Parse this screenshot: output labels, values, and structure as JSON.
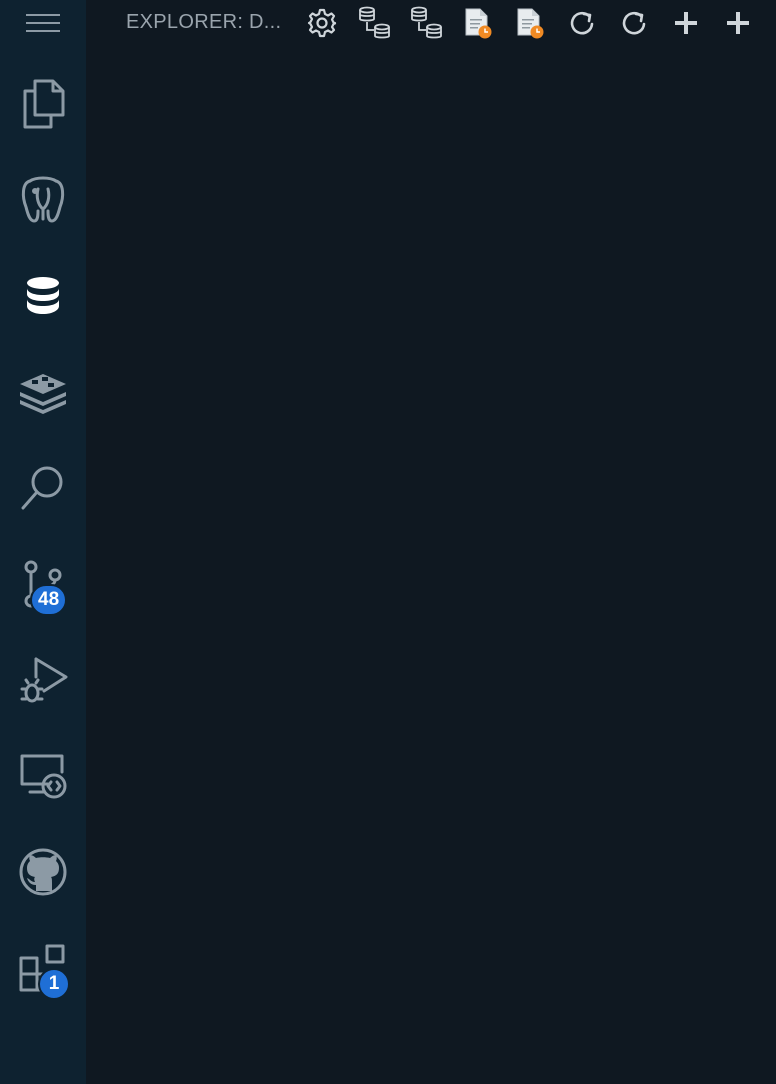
{
  "activity_bar": {
    "items": [
      {
        "name": "explorer",
        "icon": "files-icon"
      },
      {
        "name": "postgresql",
        "icon": "elephant-icon"
      },
      {
        "name": "database",
        "icon": "database-icon"
      },
      {
        "name": "redis",
        "icon": "layers-icon"
      },
      {
        "name": "search",
        "icon": "search-icon"
      },
      {
        "name": "source-control",
        "icon": "git-branch-icon",
        "badge": "48"
      },
      {
        "name": "run-debug",
        "icon": "run-debug-icon"
      },
      {
        "name": "remote-explorer",
        "icon": "remote-explorer-icon"
      },
      {
        "name": "github",
        "icon": "github-icon"
      },
      {
        "name": "extensions",
        "icon": "extensions-icon",
        "badge": "1"
      }
    ]
  },
  "panel": {
    "title": "EXPLORER: D...",
    "toolbar": [
      {
        "icon": "gear-icon"
      },
      {
        "icon": "database-tree-icon"
      },
      {
        "icon": "database-tree-icon"
      },
      {
        "icon": "document-clock-icon"
      },
      {
        "icon": "document-clock-icon"
      },
      {
        "icon": "refresh-icon"
      },
      {
        "icon": "refresh-icon"
      },
      {
        "icon": "plus-icon"
      },
      {
        "icon": "plus-icon"
      }
    ]
  },
  "colors": {
    "activity_bar_bg": "#0e2230",
    "sidebar_bg": "#0f1821",
    "icon": "#8c9aa5",
    "icon_active": "#ffffff",
    "badge": "#1f6fd6",
    "doc_accent": "#f08a24"
  }
}
